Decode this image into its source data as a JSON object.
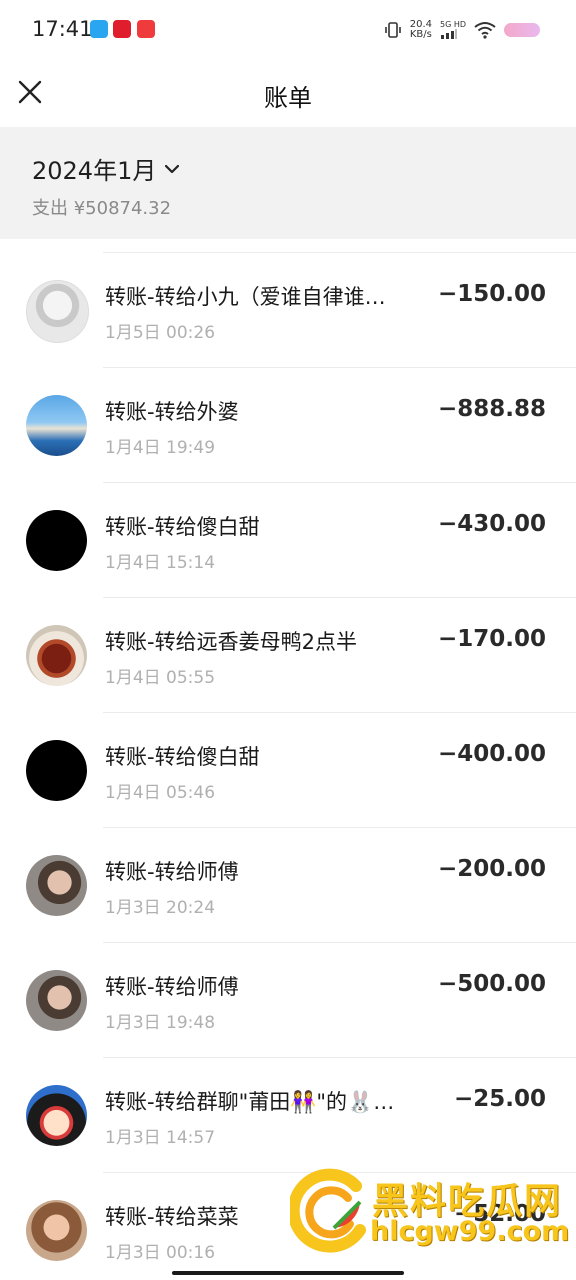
{
  "status_bar": {
    "time": "17:41",
    "net_speed": "20.4",
    "net_unit": "KB/s",
    "net_tag": "5G HD",
    "icons": [
      "vibrate-icon",
      "signal-icon",
      "wifi-icon",
      "battery-icon"
    ]
  },
  "header": {
    "title": "账单",
    "close_icon": "close-icon"
  },
  "summary": {
    "month": "2024年1月",
    "total": "支出 ¥50874.32"
  },
  "transactions": [
    {
      "title": "转账-转给小九（爱谁自律谁…",
      "time": "1月5日 00:26",
      "amount": "−150.00"
    },
    {
      "title": "转账-转给外婆",
      "time": "1月4日 19:49",
      "amount": "−888.88"
    },
    {
      "title": "转账-转给傻白甜",
      "time": "1月4日 15:14",
      "amount": "−430.00"
    },
    {
      "title": "转账-转给远香姜母鸭2点半",
      "time": "1月4日 05:55",
      "amount": "−170.00"
    },
    {
      "title": "转账-转给傻白甜",
      "time": "1月4日 05:46",
      "amount": "−400.00"
    },
    {
      "title": "转账-转给师傅",
      "time": "1月3日 20:24",
      "amount": "−200.00"
    },
    {
      "title": "转账-转给师傅",
      "time": "1月3日 19:48",
      "amount": "−500.00"
    },
    {
      "title": "转账-转给群聊\"莆田👭\"的🐰…",
      "time": "1月3日 14:57",
      "amount": "−25.00"
    },
    {
      "title": "转账-转给菜菜",
      "time": "1月3日 00:16",
      "amount": "−52.00"
    }
  ],
  "watermark": {
    "line1": "黑料吃瓜网",
    "line2": "hlcgw99.com"
  }
}
